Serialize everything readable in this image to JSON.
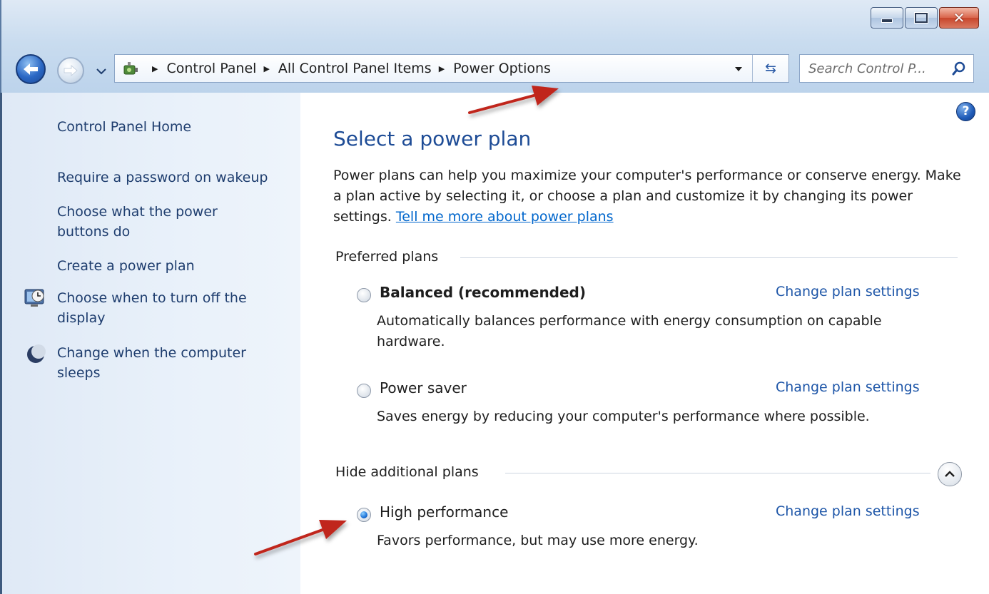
{
  "window": {
    "caption_buttons": {
      "minimize": "minimize",
      "maximize": "maximize",
      "close": "✕"
    }
  },
  "navigation": {
    "back_icon": "back-arrow-icon",
    "forward_icon": "forward-arrow-icon",
    "breadcrumbs": [
      "Control Panel",
      "All Control Panel Items",
      "Power Options"
    ],
    "refresh_glyph": "⇆"
  },
  "search": {
    "placeholder": "Search Control P..."
  },
  "sidebar": {
    "home": "Control Panel Home",
    "links": [
      "Require a password on wakeup",
      "Choose what the power buttons do",
      "Create a power plan",
      "Choose when to turn off the display",
      "Change when the computer sleeps"
    ]
  },
  "main": {
    "title": "Select a power plan",
    "intro": "Power plans can help you maximize your computer's performance or conserve energy. Make a plan active by selecting it, or choose a plan and customize it by changing its power settings.",
    "intro_link": "Tell me more about power plans",
    "help_glyph": "?",
    "preferred_label": "Preferred plans",
    "additional_label": "Hide additional plans",
    "plans": [
      {
        "name": "Balanced (recommended)",
        "description": "Automatically balances performance with energy consumption on capable hardware.",
        "link": "Change plan settings",
        "selected": false
      },
      {
        "name": "Power saver",
        "description": "Saves energy by reducing your computer's performance where possible.",
        "link": "Change plan settings",
        "selected": false
      },
      {
        "name": "High performance",
        "description": "Favors performance, but may use more energy.",
        "link": "Change plan settings",
        "selected": true
      }
    ]
  },
  "colors": {
    "link": "#1e56a8",
    "title": "#1e4c96",
    "annotation_arrow": "#c0261f"
  }
}
